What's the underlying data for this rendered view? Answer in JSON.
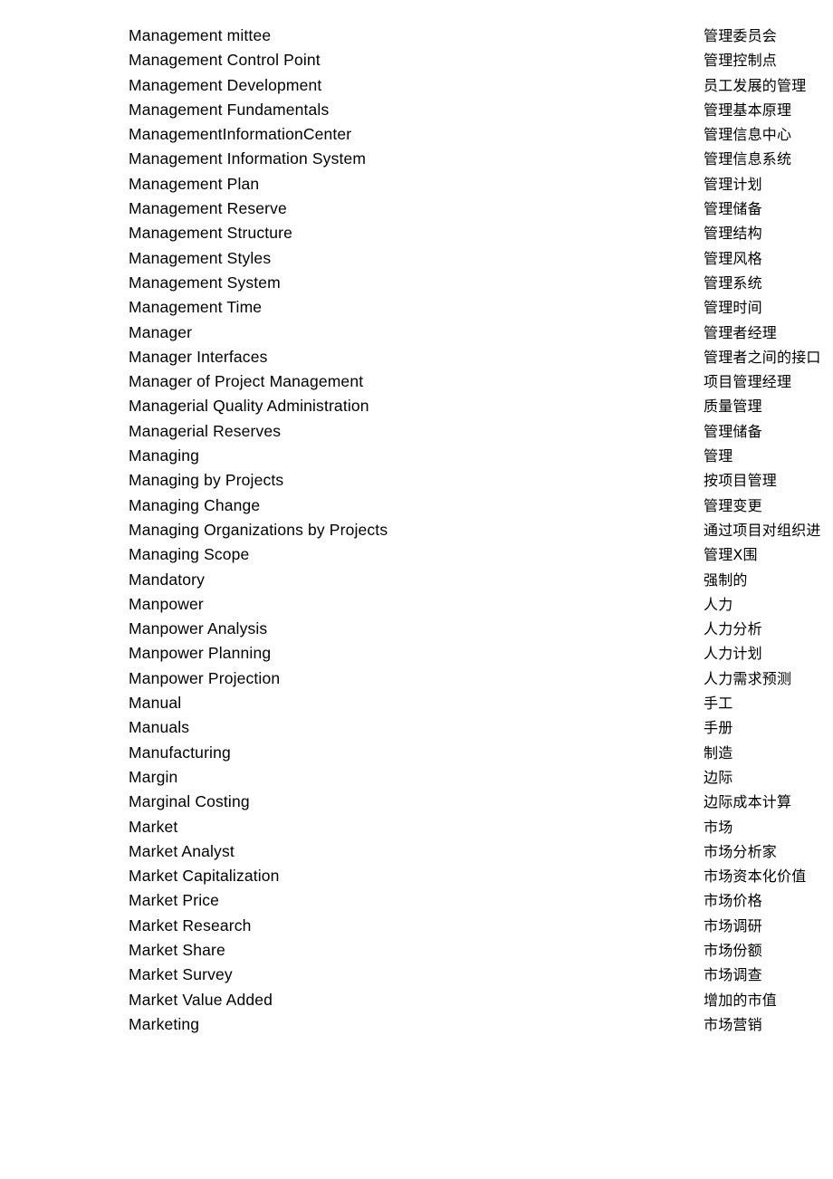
{
  "page": {
    "type": "bilingual-glossary",
    "language_columns": [
      "English",
      "Chinese"
    ],
    "row_count": 41
  },
  "entries": [
    {
      "en": "Management mittee",
      "zh": "管理委员会"
    },
    {
      "en": "Management Control Point",
      "zh": "管理控制点"
    },
    {
      "en": "Management Development",
      "zh": "员工发展的管理"
    },
    {
      "en": "Management Fundamentals",
      "zh": "管理基本原理"
    },
    {
      "en": "ManagementInformationCenter",
      "zh": "管理信息中心"
    },
    {
      "en": "Management Information System",
      "zh": "管理信息系统"
    },
    {
      "en": "Management Plan",
      "zh": "管理计划"
    },
    {
      "en": "Management Reserve",
      "zh": "管理储备"
    },
    {
      "en": "Management Structure",
      "zh": "管理结构"
    },
    {
      "en": "Management Styles",
      "zh": "管理风格"
    },
    {
      "en": "Management System",
      "zh": "管理系统"
    },
    {
      "en": "Management Time",
      "zh": "管理时间"
    },
    {
      "en": "Manager",
      "zh": "管理者经理"
    },
    {
      "en": "Manager Interfaces",
      "zh": "管理者之间的接口"
    },
    {
      "en": "Manager of Project Management",
      "zh": "项目管理经理"
    },
    {
      "en": "Managerial Quality Administration",
      "zh": "质量管理"
    },
    {
      "en": "Managerial Reserves",
      "zh": "管理储备"
    },
    {
      "en": "Managing",
      "zh": "管理"
    },
    {
      "en": "Managing by Projects",
      "zh": "按项目管理"
    },
    {
      "en": "Managing Change",
      "zh": "管理变更"
    },
    {
      "en": "Managing Organizations by Projects",
      "zh": "通过项目对组织进"
    },
    {
      "en": "Managing Scope",
      "zh": "管理X围"
    },
    {
      "en": "Mandatory",
      "zh": "强制的"
    },
    {
      "en": "Manpower",
      "zh": "人力"
    },
    {
      "en": "Manpower Analysis",
      "zh": "人力分析"
    },
    {
      "en": "Manpower Planning",
      "zh": "人力计划"
    },
    {
      "en": "Manpower Projection",
      "zh": "人力需求预测"
    },
    {
      "en": "Manual",
      "zh": "手工"
    },
    {
      "en": "Manuals",
      "zh": "手册"
    },
    {
      "en": "Manufacturing",
      "zh": "制造"
    },
    {
      "en": "Margin",
      "zh": "边际"
    },
    {
      "en": "Marginal Costing",
      "zh": "边际成本计算"
    },
    {
      "en": "Market",
      "zh": "市场"
    },
    {
      "en": "Market Analyst",
      "zh": "市场分析家"
    },
    {
      "en": "Market Capitalization",
      "zh": "市场资本化价值"
    },
    {
      "en": "Market Price",
      "zh": "市场价格"
    },
    {
      "en": "Market Research",
      "zh": "市场调研"
    },
    {
      "en": "Market Share",
      "zh": "市场份额"
    },
    {
      "en": "Market Survey",
      "zh": "市场调查"
    },
    {
      "en": "Market Value Added",
      "zh": "增加的市值"
    },
    {
      "en": "Marketing",
      "zh": "市场营销"
    }
  ]
}
